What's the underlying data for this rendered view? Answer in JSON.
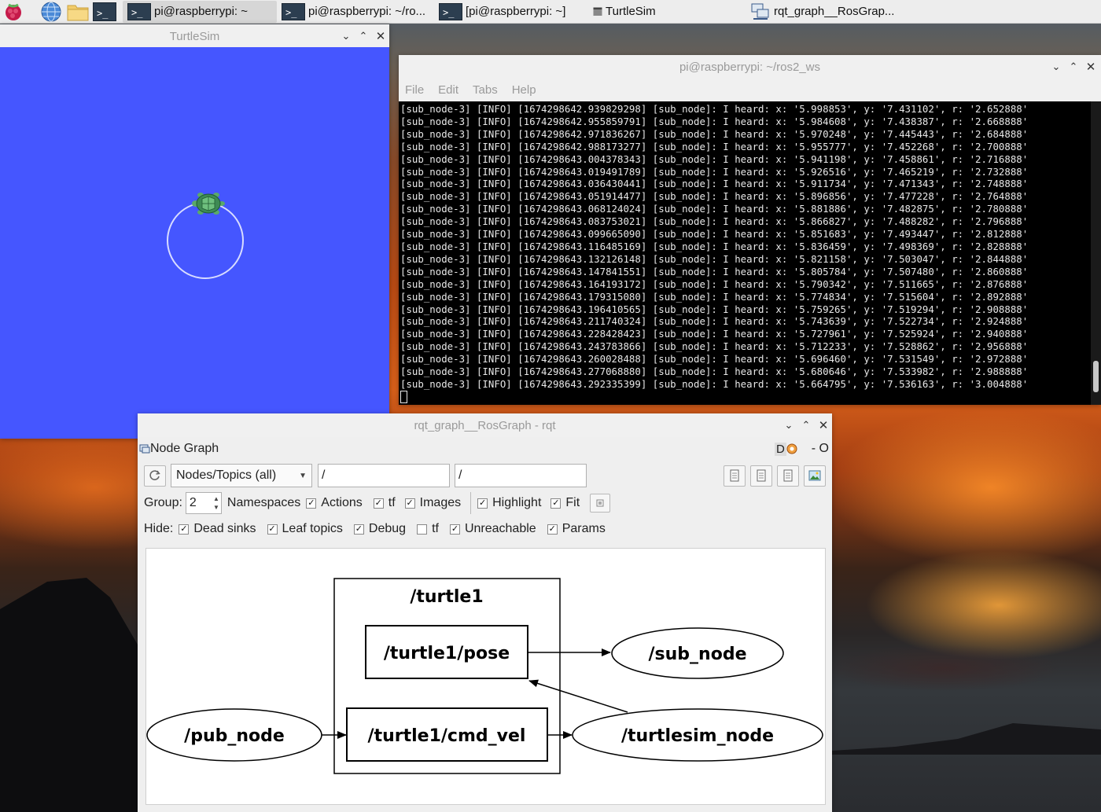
{
  "taskbar": {
    "tasks": [
      {
        "label": "pi@raspberrypi: ~",
        "active": true
      },
      {
        "label": "pi@raspberrypi: ~/ro..."
      },
      {
        "label": "[pi@raspberrypi: ~]"
      },
      {
        "label": "TurtleSim"
      },
      {
        "label": "rqt_graph__RosGrap..."
      }
    ]
  },
  "turtlesim": {
    "title": "TurtleSim",
    "background": "#4556ff"
  },
  "terminal": {
    "title": "pi@raspberrypi: ~/ros2_ws",
    "menu": [
      "File",
      "Edit",
      "Tabs",
      "Help"
    ],
    "lines": [
      "[sub_node-3] [INFO] [1674298642.939829298] [sub_node]: I heard: x: '5.998853', y: '7.431102', r: '2.652888'",
      "[sub_node-3] [INFO] [1674298642.955859791] [sub_node]: I heard: x: '5.984608', y: '7.438387', r: '2.668888'",
      "[sub_node-3] [INFO] [1674298642.971836267] [sub_node]: I heard: x: '5.970248', y: '7.445443', r: '2.684888'",
      "[sub_node-3] [INFO] [1674298642.988173277] [sub_node]: I heard: x: '5.955777', y: '7.452268', r: '2.700888'",
      "[sub_node-3] [INFO] [1674298643.004378343] [sub_node]: I heard: x: '5.941198', y: '7.458861', r: '2.716888'",
      "[sub_node-3] [INFO] [1674298643.019491789] [sub_node]: I heard: x: '5.926516', y: '7.465219', r: '2.732888'",
      "[sub_node-3] [INFO] [1674298643.036430441] [sub_node]: I heard: x: '5.911734', y: '7.471343', r: '2.748888'",
      "[sub_node-3] [INFO] [1674298643.051914477] [sub_node]: I heard: x: '5.896856', y: '7.477228', r: '2.764888'",
      "[sub_node-3] [INFO] [1674298643.068124024] [sub_node]: I heard: x: '5.881886', y: '7.482875', r: '2.780888'",
      "[sub_node-3] [INFO] [1674298643.083753021] [sub_node]: I heard: x: '5.866827', y: '7.488282', r: '2.796888'",
      "[sub_node-3] [INFO] [1674298643.099665090] [sub_node]: I heard: x: '5.851683', y: '7.493447', r: '2.812888'",
      "[sub_node-3] [INFO] [1674298643.116485169] [sub_node]: I heard: x: '5.836459', y: '7.498369', r: '2.828888'",
      "[sub_node-3] [INFO] [1674298643.132126148] [sub_node]: I heard: x: '5.821158', y: '7.503047', r: '2.844888'",
      "[sub_node-3] [INFO] [1674298643.147841551] [sub_node]: I heard: x: '5.805784', y: '7.507480', r: '2.860888'",
      "[sub_node-3] [INFO] [1674298643.164193172] [sub_node]: I heard: x: '5.790342', y: '7.511665', r: '2.876888'",
      "[sub_node-3] [INFO] [1674298643.179315080] [sub_node]: I heard: x: '5.774834', y: '7.515604', r: '2.892888'",
      "[sub_node-3] [INFO] [1674298643.196410565] [sub_node]: I heard: x: '5.759265', y: '7.519294', r: '2.908888'",
      "[sub_node-3] [INFO] [1674298643.211740324] [sub_node]: I heard: x: '5.743639', y: '7.522734', r: '2.924888'",
      "[sub_node-3] [INFO] [1674298643.228428423] [sub_node]: I heard: x: '5.727961', y: '7.525924', r: '2.940888'",
      "[sub_node-3] [INFO] [1674298643.243783866] [sub_node]: I heard: x: '5.712233', y: '7.528862', r: '2.956888'",
      "[sub_node-3] [INFO] [1674298643.260028488] [sub_node]: I heard: x: '5.696460', y: '7.531549', r: '2.972888'",
      "[sub_node-3] [INFO] [1674298643.277068880] [sub_node]: I heard: x: '5.680646', y: '7.533982', r: '2.988888'",
      "[sub_node-3] [INFO] [1674298643.292335399] [sub_node]: I heard: x: '5.664795', y: '7.536163', r: '3.004888'"
    ]
  },
  "rqt": {
    "title": "rqt_graph__RosGraph - rqt",
    "plugin_title": "Node Graph",
    "plugin_badges": {
      "d": "D",
      "dash": "- O"
    },
    "mode_combo": "Nodes/Topics (all)",
    "filter1": "/",
    "filter2": "/",
    "group_label": "Group:",
    "group_value": "2",
    "group_options": [
      {
        "label": "Namespaces",
        "checked": true
      },
      {
        "label": "Actions",
        "checked": true
      },
      {
        "label": "tf",
        "checked": true
      },
      {
        "label": "Images",
        "checked": true
      }
    ],
    "view_options": [
      {
        "label": "Highlight",
        "checked": true
      },
      {
        "label": "Fit",
        "checked": true
      }
    ],
    "hide_label": "Hide:",
    "hide_options": [
      {
        "label": "Dead sinks",
        "checked": true
      },
      {
        "label": "Leaf topics",
        "checked": true
      },
      {
        "label": "Debug",
        "checked": true
      },
      {
        "label": "tf",
        "checked": false
      },
      {
        "label": "Unreachable",
        "checked": true
      },
      {
        "label": "Params",
        "checked": true
      }
    ],
    "graph": {
      "cluster": "/turtle1",
      "topic_pose": "/turtle1/pose",
      "topic_cmd_vel": "/turtle1/cmd_vel",
      "node_sub": "/sub_node",
      "node_pub": "/pub_node",
      "node_turtlesim": "/turtlesim_node"
    }
  }
}
